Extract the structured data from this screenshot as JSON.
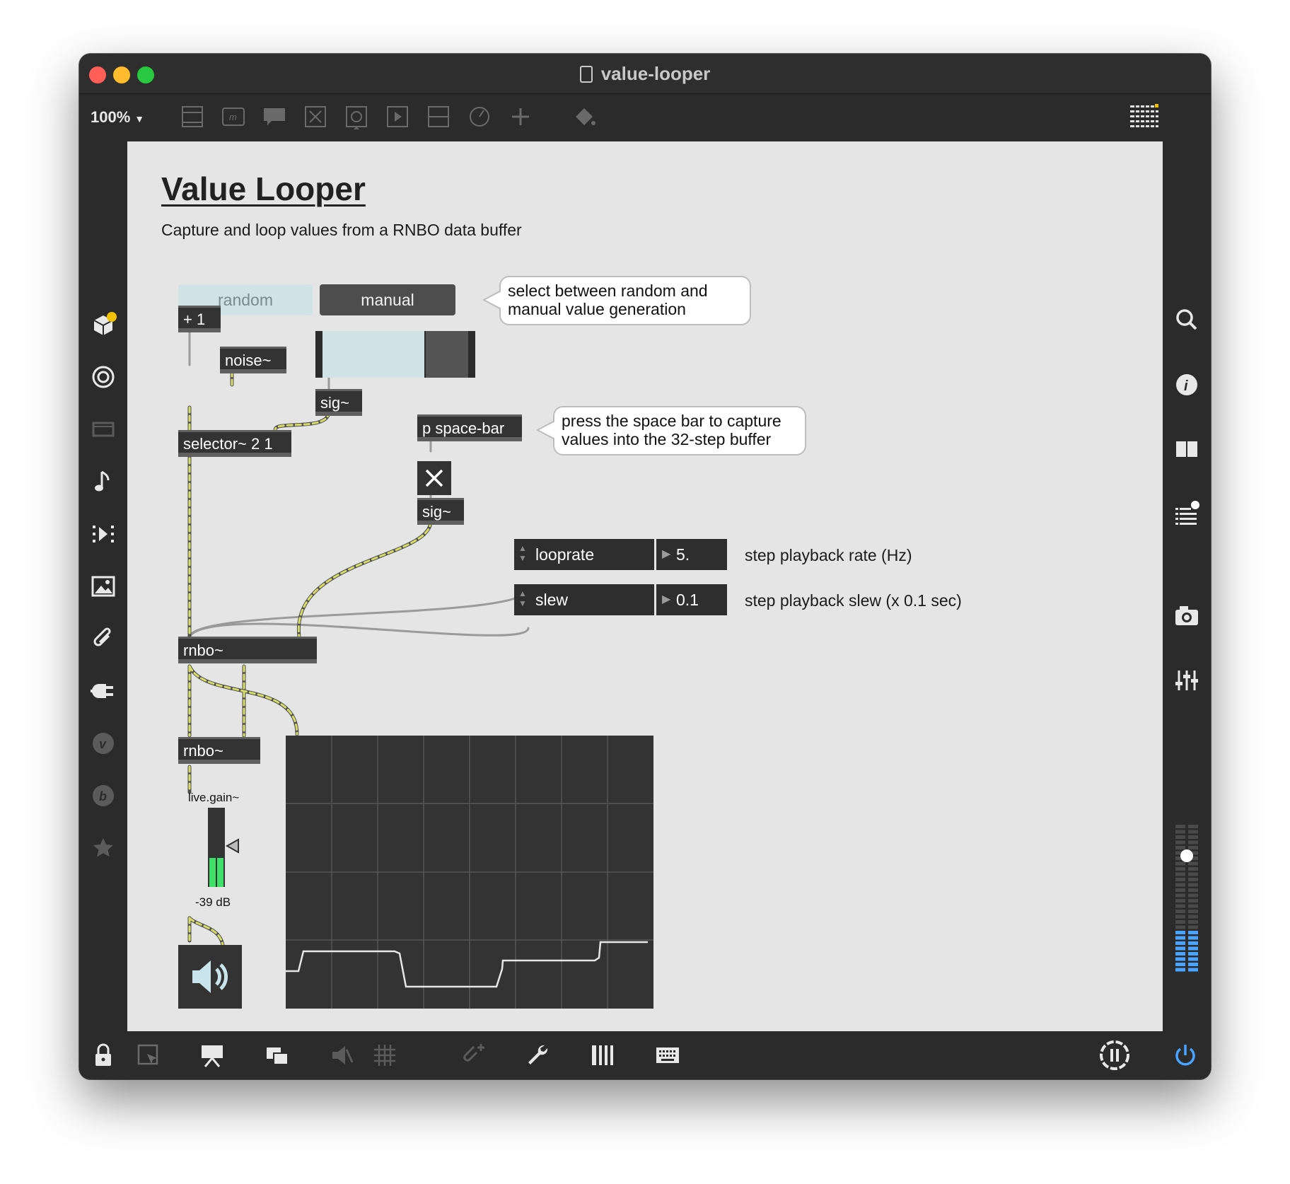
{
  "window": {
    "title": "value-looper"
  },
  "toolbar": {
    "zoom": "100%"
  },
  "patch": {
    "title": "Value Looper",
    "subtitle": "Capture and loop values from a RNBO data buffer",
    "buttons": {
      "random": "random",
      "manual": "manual"
    },
    "objects": {
      "plus_one": "+ 1",
      "noise": "noise~",
      "sig1": "sig~",
      "selector": "selector~ 2 1",
      "space_bar": "p space-bar",
      "sig2": "sig~",
      "rnbo1": "rnbo~",
      "rnbo2": "rnbo~"
    },
    "comments": {
      "select": "select between random and manual value generation",
      "press": "press the space bar to capture values into the 32-step buffer"
    },
    "params": [
      {
        "name": "looprate",
        "value": "5.",
        "desc": "step playback rate (Hz)"
      },
      {
        "name": "slew",
        "value": "0.1",
        "desc": "step playback slew (x 0.1 sec)"
      }
    ],
    "live_gain": {
      "label": "live.gain~",
      "value": "-39 dB",
      "level": 0.37
    },
    "slider": {
      "level": 0.7
    }
  }
}
